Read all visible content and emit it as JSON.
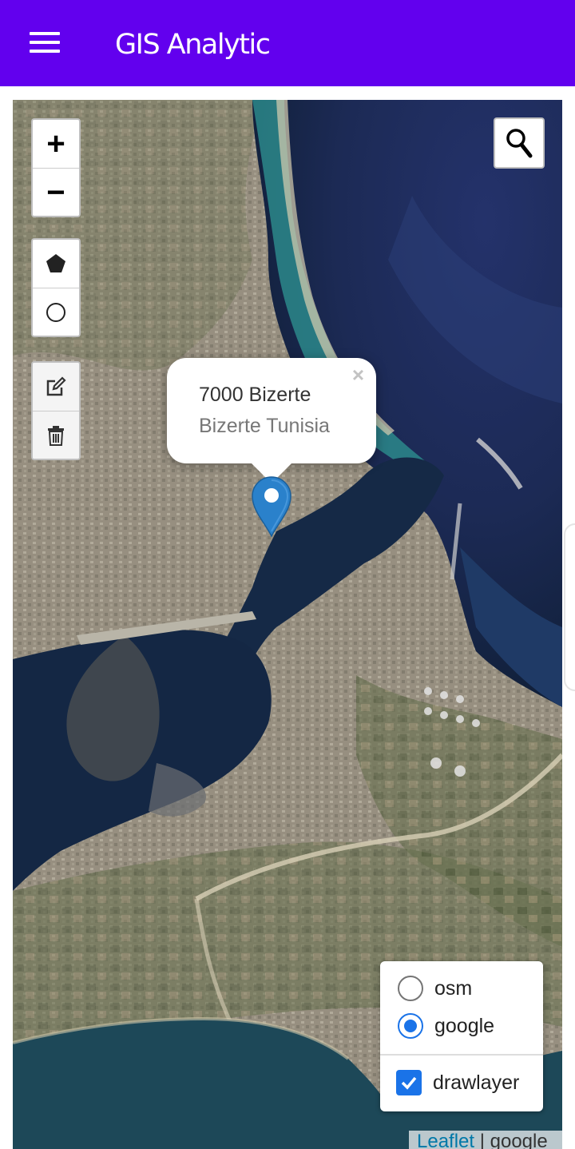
{
  "app": {
    "title": "GIS Analytic"
  },
  "popup": {
    "line1": "7000 Bizerte",
    "line2": "Bizerte Tunisia",
    "close": "×"
  },
  "layers": {
    "base": [
      {
        "label": "osm",
        "checked": false
      },
      {
        "label": "google",
        "checked": true
      }
    ],
    "overlay": [
      {
        "label": "drawlayer",
        "checked": true
      }
    ]
  },
  "attribution": {
    "link": "Leaflet",
    "rest": " | google"
  },
  "icons": {
    "menu": "hamburger-icon",
    "zoom_in": "+",
    "zoom_out": "−",
    "polygon": "pentagon-icon",
    "circle": "circle-icon",
    "edit": "edit-icon",
    "delete": "trash-icon",
    "search": "search-icon",
    "marker": "map-pin-icon"
  },
  "colors": {
    "appbar": "#6200ee",
    "marker": "#2a81cb",
    "radio_checked": "#1a73e8"
  }
}
